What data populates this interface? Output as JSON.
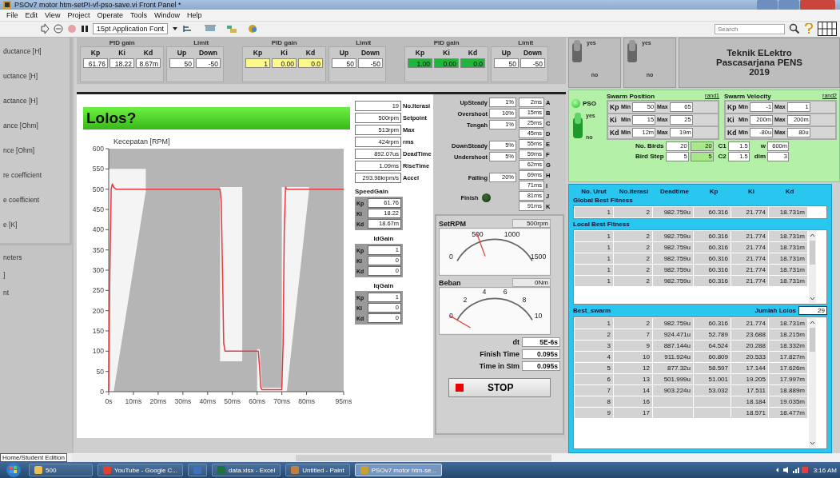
{
  "window": {
    "title": "PSOv7 motor htm-setPI-vf-pso-save.vi Front Panel *"
  },
  "menu": [
    "File",
    "Edit",
    "View",
    "Project",
    "Operate",
    "Tools",
    "Window",
    "Help"
  ],
  "toolbar": {
    "font": "15pt Application Font",
    "search": {
      "placeholder": "Search"
    }
  },
  "side_labels": [
    "ductance [H]",
    "uctance [H]",
    "actance [H]",
    "ance [Ohm]",
    "nce [Ohm]",
    "re coefficient",
    "e coefficient",
    "e [K]"
  ],
  "side_labels_2": [
    "neters",
    "]",
    "nt"
  ],
  "gain_groups": [
    {
      "pid_title": "PID gain",
      "limit_title": "Limit",
      "gains": [
        {
          "label": "Kp",
          "value": "61.76",
          "color": "#ffffff"
        },
        {
          "label": "Ki",
          "value": "18.22",
          "color": "#ffffff"
        },
        {
          "label": "Kd",
          "value": "8.67m",
          "color": "#ffffff"
        }
      ],
      "limits": [
        {
          "label": "Up",
          "value": "50"
        },
        {
          "label": "Down",
          "value": "-50"
        }
      ]
    },
    {
      "pid_title": "PID gain",
      "limit_title": "Limit",
      "gains": [
        {
          "label": "Kp",
          "value": "1",
          "color": "#fdf98a"
        },
        {
          "label": "Ki",
          "value": "0.00",
          "color": "#fdf98a"
        },
        {
          "label": "Kd",
          "value": "0.0",
          "color": "#fdf98a"
        }
      ],
      "limits": [
        {
          "label": "Up",
          "value": "50"
        },
        {
          "label": "Down",
          "value": "-50"
        }
      ]
    },
    {
      "pid_title": "PID gain",
      "limit_title": "Limit",
      "gains": [
        {
          "label": "Kp",
          "value": "1.00",
          "color": "#1fb53a"
        },
        {
          "label": "Ki",
          "value": "0.00",
          "color": "#1fb53a"
        },
        {
          "label": "Kd",
          "value": "0.0",
          "color": "#1fb53a"
        }
      ],
      "limits": [
        {
          "label": "Up",
          "value": "50"
        },
        {
          "label": "Down",
          "value": "-50"
        }
      ]
    }
  ],
  "toggles": [
    {
      "on_label": "yes",
      "off_label": "no",
      "on": true
    },
    {
      "on_label": "yes",
      "off_label": "no",
      "on": true
    }
  ],
  "institution": [
    "Teknik ELektro",
    "Pascasarjana PENS",
    "2019"
  ],
  "banner": {
    "text": "Lolos?"
  },
  "chart": {
    "chart_data": {
      "type": "line",
      "title": "Kecepatan [RPM]",
      "x": [
        0,
        0.5,
        1,
        1.5,
        2,
        3,
        10,
        45,
        45.5,
        46,
        46.5,
        47,
        60.5,
        61,
        61.5,
        62,
        70,
        70.5,
        71,
        71.5,
        72,
        95
      ],
      "series": [
        {
          "color": "#e8383d",
          "values": [
            0,
            300,
            500,
            513,
            505,
            500,
            500,
            500,
            470,
            300,
            120,
            100,
            100,
            60,
            10,
            5,
            5,
            120,
            400,
            505,
            500,
            500
          ]
        }
      ],
      "xlim": [
        0,
        95
      ],
      "ylim": [
        0,
        600
      ],
      "xticks": [
        {
          "value": 0,
          "label": "0s"
        },
        {
          "value": 10,
          "label": "10ms"
        },
        {
          "value": 20,
          "label": "20ms"
        },
        {
          "value": 30,
          "label": "30ms"
        },
        {
          "value": 40,
          "label": "40ms"
        },
        {
          "value": 50,
          "label": "50ms"
        },
        {
          "value": 60,
          "label": "60ms"
        },
        {
          "value": 70,
          "label": "70ms"
        },
        {
          "value": 80,
          "label": "80ms"
        },
        {
          "value": 95,
          "label": "95ms"
        }
      ],
      "yticks": [
        0,
        50,
        100,
        150,
        200,
        250,
        300,
        350,
        400,
        450,
        500,
        550,
        600
      ]
    }
  },
  "indicators": [
    {
      "value": "19",
      "label": "No.Iterasi"
    },
    {
      "value": "500rpm",
      "label": "Setpoint"
    },
    {
      "value": "513rpm",
      "label": "Max"
    },
    {
      "value": "424rpm",
      "label": "rms"
    },
    {
      "value": "892.07us",
      "label": "DeadTime"
    },
    {
      "value": "1.09ms",
      "label": "RiseTime"
    },
    {
      "value": "293.98krpm/s",
      "label": "Accel"
    }
  ],
  "gain_clusters": [
    {
      "title": "SpeedGain",
      "rows": [
        {
          "label": "Kp",
          "value": "61.76"
        },
        {
          "label": "Ki",
          "value": "18.22"
        },
        {
          "label": "Kd",
          "value": "18.67m"
        }
      ]
    },
    {
      "title": "IdGain",
      "rows": [
        {
          "label": "Kp",
          "value": "1"
        },
        {
          "label": "Ki",
          "value": "0"
        },
        {
          "label": "Kd",
          "value": "0"
        }
      ]
    },
    {
      "title": "IqGain",
      "rows": [
        {
          "label": "Kp",
          "value": "1"
        },
        {
          "label": "Ki",
          "value": "0"
        },
        {
          "label": "Kd",
          "value": "0"
        }
      ]
    }
  ],
  "criteria": [
    {
      "label": "UpSteady",
      "value": "1%"
    },
    {
      "label": "Overshoot",
      "value": "10%"
    },
    {
      "label": "Tengah",
      "value": "1%"
    },
    {
      "label": "DownSteady",
      "value": "5%"
    },
    {
      "label": "Undershoot",
      "value": "5%"
    },
    {
      "label": "Falling",
      "value": "20%"
    }
  ],
  "markers": [
    {
      "value": "2ms",
      "letter": "A"
    },
    {
      "value": "15ms",
      "letter": "B"
    },
    {
      "value": "25ms",
      "letter": "C"
    },
    {
      "value": "45ms",
      "letter": "D"
    },
    {
      "value": "55ms",
      "letter": "E"
    },
    {
      "value": "59ms",
      "letter": "F"
    },
    {
      "value": "62ms",
      "letter": "G"
    },
    {
      "value": "69ms",
      "letter": "H"
    },
    {
      "value": "71ms",
      "letter": "I"
    },
    {
      "value": "81ms",
      "letter": "J"
    },
    {
      "value": "91ms",
      "letter": "K"
    }
  ],
  "finish": {
    "label": "Finish",
    "on": false
  },
  "gauges": [
    {
      "label": "SetRPM",
      "value": "500rpm",
      "scale": [
        "0",
        "500",
        "1000",
        "1500"
      ]
    },
    {
      "label": "Beban",
      "value": "0Nm",
      "scale": [
        "0",
        "2",
        "4",
        "6",
        "8",
        "10"
      ]
    }
  ],
  "timing": [
    {
      "label": "dt",
      "value": "5E-6s"
    },
    {
      "label": "Finish Time",
      "value": "0.095s"
    },
    {
      "label": "Time in SIm",
      "value": "0.095s"
    }
  ],
  "stop_button": {
    "label": "STOP"
  },
  "pso": {
    "led_label": "PSO",
    "led_on": true,
    "switch": {
      "on_label": "yes",
      "off_label": "no",
      "on": true
    },
    "panels": [
      {
        "title": "Swarm Position",
        "rand": "rand1",
        "rows": [
          {
            "label": "Kp",
            "min_label": "Min",
            "min": "50",
            "max_label": "Max",
            "max": "65"
          },
          {
            "label": "Ki",
            "min_label": "Min",
            "min": "15",
            "max_label": "Max",
            "max": "25"
          },
          {
            "label": "Kd",
            "min_label": "Min",
            "min": "12m",
            "max_label": "Max",
            "max": "19m"
          }
        ]
      },
      {
        "title": "Swarm Velocity",
        "rand": "rand2",
        "rows": [
          {
            "label": "Kp",
            "min_label": "Min",
            "min": "-1",
            "max_label": "Max",
            "max": "1"
          },
          {
            "label": "Ki",
            "min_label": "Min",
            "min": "200m",
            "max_label": "Max",
            "max": "200m"
          },
          {
            "label": "Kd",
            "min_label": "Min",
            "min": "-80u",
            "max_label": "Max",
            "max": "80u"
          }
        ]
      }
    ],
    "birds": [
      {
        "label": "No. Birds",
        "value": "20",
        "current": "20"
      },
      {
        "label": "Bird Step",
        "value": "5",
        "current": "5"
      }
    ],
    "coefs": [
      {
        "label": "C1",
        "value": "1.5"
      },
      {
        "label": "C2",
        "value": "1.5"
      }
    ],
    "params": [
      {
        "label": "w",
        "value": "600m"
      },
      {
        "label": "dim",
        "value": "3"
      }
    ]
  },
  "tables": {
    "columns": [
      "No. Urut",
      "No.iterasi",
      "Deadtime",
      "Kp",
      "Ki",
      "Kd"
    ],
    "global": {
      "title": "Global Best Fitness",
      "rows": [
        [
          "1",
          "2",
          "982.759u",
          "60.316",
          "21.774",
          "18.731m"
        ]
      ]
    },
    "local": {
      "title": "Local Best Fitness",
      "rows": [
        [
          "1",
          "2",
          "982.759u",
          "60.316",
          "21.774",
          "18.731m"
        ],
        [
          "1",
          "2",
          "982.759u",
          "60.316",
          "21.774",
          "18.731m"
        ],
        [
          "1",
          "2",
          "982.759u",
          "60.316",
          "21.774",
          "18.731m"
        ],
        [
          "1",
          "2",
          "982.759u",
          "60.316",
          "21.774",
          "18.731m"
        ],
        [
          "1",
          "2",
          "982.759u",
          "60.316",
          "21.774",
          "18.731m"
        ]
      ]
    },
    "best": {
      "title": "Best_swarm",
      "count_label": "Jumlah Lolos",
      "count": "29",
      "rows": [
        [
          "1",
          "2",
          "982.759u",
          "60.316",
          "21.774",
          "18.731m"
        ],
        [
          "2",
          "7",
          "924.471u",
          "52.789",
          "23.688",
          "18.215m"
        ],
        [
          "3",
          "9",
          "887.144u",
          "64.524",
          "20.288",
          "18.332m"
        ],
        [
          "4",
          "10",
          "911.924u",
          "60.809",
          "20.533",
          "17.827m"
        ],
        [
          "5",
          "12",
          "877.32u",
          "58.597",
          "17.144",
          "17.626m"
        ],
        [
          "6",
          "13",
          "501.999u",
          "51.001",
          "19.205",
          "17.997m"
        ],
        [
          "7",
          "14",
          "903.224u",
          "53.032",
          "17.511",
          "18.889m"
        ],
        [
          "8",
          "16",
          null,
          null,
          "18.184",
          "19.035m"
        ],
        [
          "9",
          "17",
          null,
          null,
          "18.571",
          "18.477m"
        ]
      ]
    }
  },
  "status": {
    "edition": "Home/Student Edition"
  },
  "taskbar": {
    "items": [
      {
        "label": "500",
        "selected": false
      },
      {
        "label": "YouTube - Google C...",
        "selected": false
      },
      {
        "selected": false
      },
      {
        "label": "data.xlsx - Excel",
        "selected": false
      },
      {
        "label": "Untitled - Paint",
        "selected": false
      },
      {
        "label": "PSOv7 motor htm-se...",
        "selected": true
      }
    ],
    "clock": "3:16 AM"
  }
}
